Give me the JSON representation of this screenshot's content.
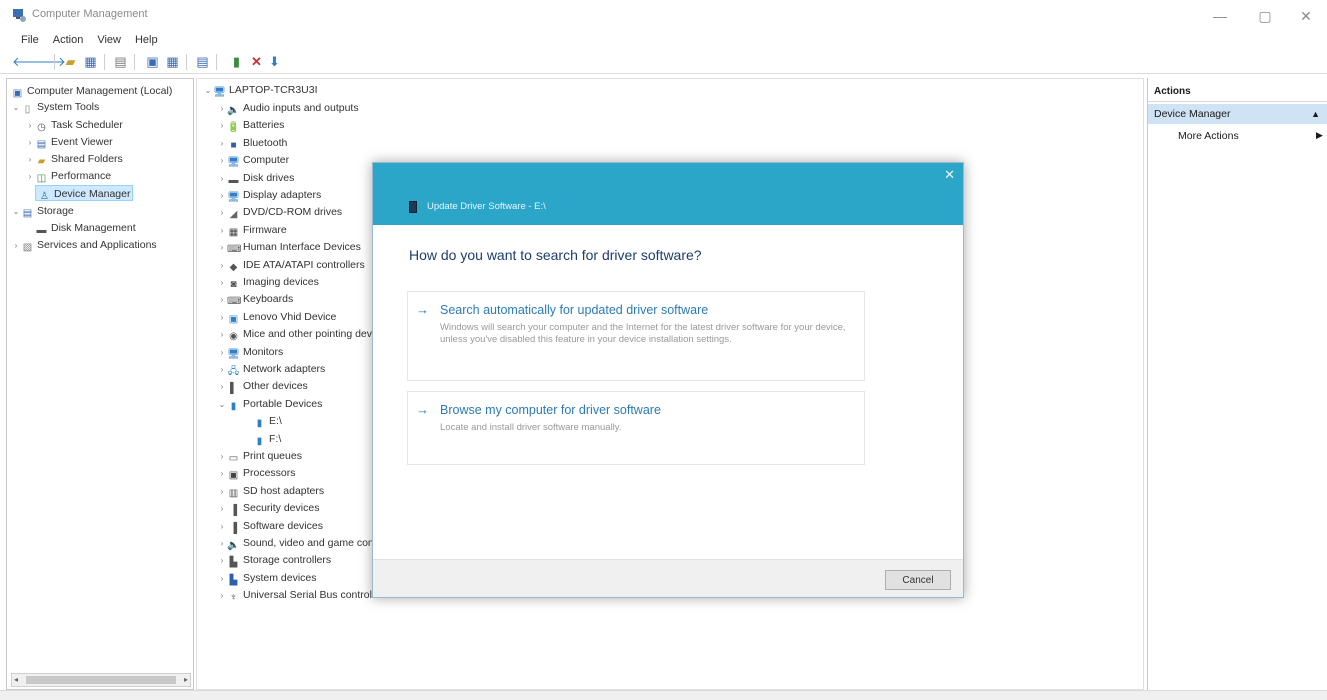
{
  "window": {
    "title": "Computer Management",
    "minimize": "—",
    "maximize": "▢",
    "close": "✕"
  },
  "menu": [
    "File",
    "Action",
    "View",
    "Help"
  ],
  "left_tree": {
    "root": "Computer Management (Local)",
    "system_tools": "System Tools",
    "task_scheduler": "Task Scheduler",
    "event_viewer": "Event Viewer",
    "shared_folders": "Shared Folders",
    "performance": "Performance",
    "device_manager": "Device Manager",
    "storage": "Storage",
    "disk_management": "Disk Management",
    "services_apps": "Services and Applications"
  },
  "device_tree": {
    "computer_name": "LAPTOP-TCR3U3I",
    "categories": [
      {
        "label": "Audio inputs and outputs",
        "icon": "audio-icon",
        "glyph": "🔈",
        "color": "#4a7a3a"
      },
      {
        "label": "Batteries",
        "icon": "battery-icon",
        "glyph": "🔋",
        "color": "#3a6a2a"
      },
      {
        "label": "Bluetooth",
        "icon": "bluetooth-icon",
        "glyph": "■",
        "color": "#2f5fa8"
      },
      {
        "label": "Computer",
        "icon": "computer-icon",
        "glyph": "🖥",
        "color": "#2f7fc8"
      },
      {
        "label": "Disk drives",
        "icon": "disk-drive-icon",
        "glyph": "▬",
        "color": "#555555"
      },
      {
        "label": "Display adapters",
        "icon": "display-adapter-icon",
        "glyph": "🖥",
        "color": "#2f7fc8"
      },
      {
        "label": "DVD/CD-ROM drives",
        "icon": "dvd-drive-icon",
        "glyph": "◢",
        "color": "#666666"
      },
      {
        "label": "Firmware",
        "icon": "firmware-icon",
        "glyph": "▦",
        "color": "#444444"
      },
      {
        "label": "Human Interface Devices",
        "icon": "hid-icon",
        "glyph": "⌨",
        "color": "#555555"
      },
      {
        "label": "IDE ATA/ATAPI controllers",
        "icon": "ide-controller-icon",
        "glyph": "◆",
        "color": "#555555"
      },
      {
        "label": "Imaging devices",
        "icon": "camera-icon",
        "glyph": "◙",
        "color": "#555555"
      },
      {
        "label": "Keyboards",
        "icon": "keyboard-icon",
        "glyph": "⌨",
        "color": "#555555"
      },
      {
        "label": "Lenovo Vhid Device",
        "icon": "vhid-icon",
        "glyph": "▣",
        "color": "#2f7fc8"
      },
      {
        "label": "Mice and other pointing devices",
        "icon": "mouse-icon",
        "glyph": "◉",
        "color": "#555555"
      },
      {
        "label": "Monitors",
        "icon": "monitor-icon",
        "glyph": "🖥",
        "color": "#2f7fc8"
      },
      {
        "label": "Network adapters",
        "icon": "network-adapter-icon",
        "glyph": "🖧",
        "color": "#2f7fc8"
      },
      {
        "label": "Other devices",
        "icon": "other-device-icon",
        "glyph": "▌",
        "color": "#555555"
      }
    ],
    "portable_devices": "Portable Devices",
    "portable_children": [
      "E:\\",
      "F:\\"
    ],
    "categories_after": [
      {
        "label": "Print queues",
        "icon": "print-queue-icon",
        "glyph": "▭",
        "color": "#555555"
      },
      {
        "label": "Processors",
        "icon": "processor-icon",
        "glyph": "▣",
        "color": "#444444"
      },
      {
        "label": "SD host adapters",
        "icon": "sd-host-icon",
        "glyph": "▥",
        "color": "#555555"
      },
      {
        "label": "Security devices",
        "icon": "security-device-icon",
        "glyph": "▐",
        "color": "#555555"
      },
      {
        "label": "Software devices",
        "icon": "software-device-icon",
        "glyph": "▐",
        "color": "#555555"
      },
      {
        "label": "Sound, video and game controllers",
        "icon": "sound-icon",
        "glyph": "🔈",
        "color": "#4a7a3a"
      },
      {
        "label": "Storage controllers",
        "icon": "storage-controller-icon",
        "glyph": "▙",
        "color": "#555555"
      },
      {
        "label": "System devices",
        "icon": "system-device-icon",
        "glyph": "▙",
        "color": "#2f5fa8"
      },
      {
        "label": "Universal Serial Bus controllers",
        "icon": "usb-icon",
        "glyph": "♆",
        "color": "#555555"
      }
    ]
  },
  "actions": {
    "heading": "Actions",
    "section": "Device Manager",
    "section_arrow": "▲",
    "more": "More Actions",
    "more_arrow": "▶"
  },
  "dialog": {
    "header_title": "Update Driver Software - E:\\",
    "close": "✕",
    "question": "How do you want to search for driver software?",
    "option1_arrow": "→",
    "option1_title": "Search automatically for updated driver software",
    "option1_desc": "Windows will search your computer and the Internet for the latest driver software for your device, unless you've disabled this feature in your device installation settings.",
    "option2_arrow": "→",
    "option2_title": "Browse my computer for driver software",
    "option2_desc": "Locate and install driver software manually.",
    "cancel_label": "Cancel"
  },
  "colors": {
    "dialog_header": "#2ba5c8",
    "link_blue": "#2b7bb8",
    "selection": "#cde8ff"
  }
}
